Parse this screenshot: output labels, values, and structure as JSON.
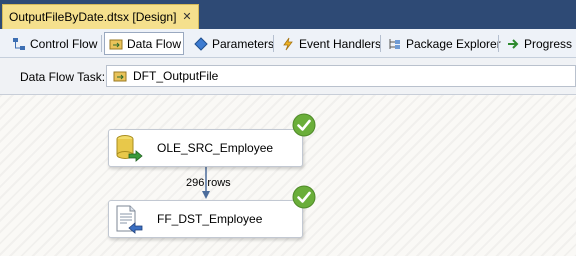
{
  "document_tab": {
    "title": "OutputFileByDate.dtsx [Design]",
    "close_glyph": "✕"
  },
  "designer_tabs": [
    {
      "label": "Control Flow",
      "icon": "control-flow-icon",
      "active": false
    },
    {
      "label": "Data Flow",
      "icon": "data-flow-icon",
      "active": true
    },
    {
      "label": "Parameters",
      "icon": "parameters-icon",
      "active": false
    },
    {
      "label": "Event Handlers",
      "icon": "event-handlers-icon",
      "active": false
    },
    {
      "label": "Package Explorer",
      "icon": "package-explorer-icon",
      "active": false
    },
    {
      "label": "Progress",
      "icon": "progress-icon",
      "active": false
    }
  ],
  "task_bar": {
    "label": "Data Flow Task:",
    "selected_task": "DFT_OutputFile"
  },
  "components": {
    "source": {
      "name": "OLE_SRC_Employee",
      "status": "success"
    },
    "destination": {
      "name": "FF_DST_Employee",
      "status": "success"
    }
  },
  "path": {
    "rows_label": "296 rows"
  },
  "colors": {
    "success": "#6aae3a",
    "arrow": "#4c6d9c",
    "doc_tab_bg": "#f5e08d",
    "title_bar": "#2e4a75"
  }
}
